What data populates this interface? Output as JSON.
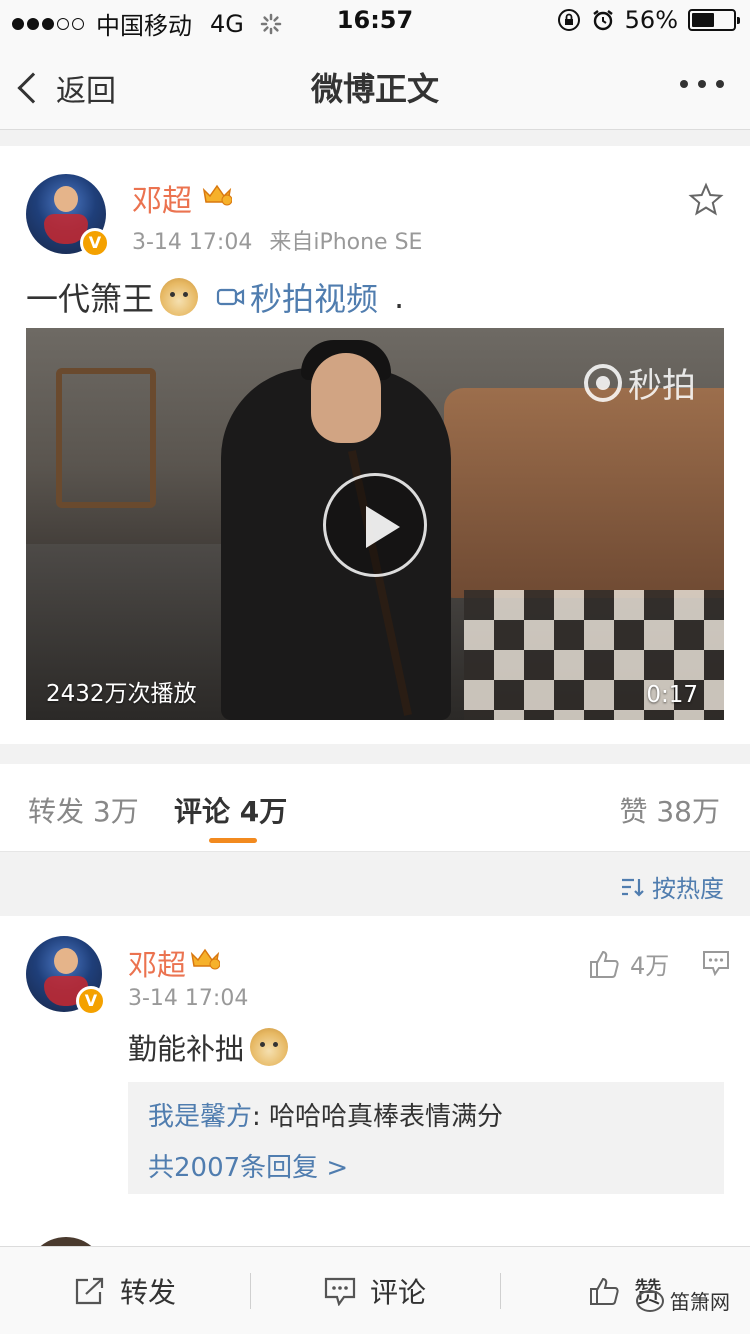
{
  "status_bar": {
    "carrier": "中国移动",
    "network": "4G",
    "time": "16:57",
    "battery": "56%",
    "battery_level": 0.56,
    "signal_bars_filled": 3
  },
  "nav": {
    "back_label": "返回",
    "title": "微博正文"
  },
  "post": {
    "username": "邓超",
    "timestamp": "3-14 17:04",
    "source": "来自iPhone SE",
    "text": "一代箫王",
    "video_link": "秒拍视频",
    "trailing": ".",
    "video": {
      "watermark": "秒拍",
      "play_count": "2432万次播放",
      "duration": "0:17"
    }
  },
  "tabs": {
    "repost": "转发 3万",
    "comments": "评论 4万",
    "likes": "赞 38万"
  },
  "sort_label": "按热度",
  "comment": {
    "username": "邓超",
    "timestamp": "3-14 17:04",
    "likes": "4万",
    "text": "勤能补拙",
    "reply_nick": "我是馨方",
    "reply_text": ": 哈哈哈真棒表情满分",
    "reply_count": "共2007条回复 >"
  },
  "toolbar": {
    "repost": "转发",
    "comment": "评论",
    "like": "赞",
    "brand": "笛箫网"
  },
  "colors": {
    "accent_orange": "#eb7350",
    "link_blue": "#507daf",
    "tab_indicator": "#f28a1f",
    "verified_badge": "#f4a100"
  }
}
